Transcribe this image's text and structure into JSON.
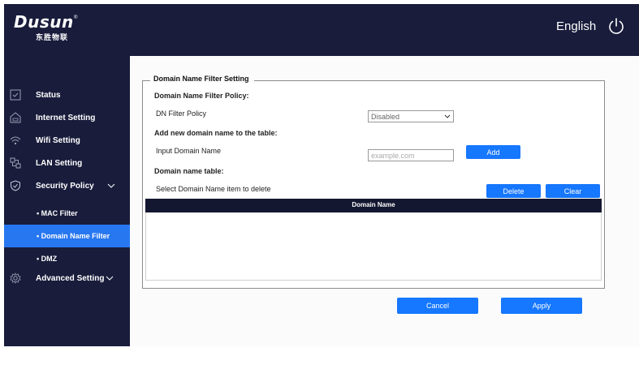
{
  "header": {
    "logo_text": "Dusun",
    "logo_subtext": "东胜物联",
    "logo_reg": "®",
    "language": "English",
    "power_icon": "power-icon"
  },
  "sidebar": {
    "items": [
      {
        "label": "Status",
        "icon": "status-icon"
      },
      {
        "label": "Internet Setting",
        "icon": "internet-icon"
      },
      {
        "label": "Wifi Setting",
        "icon": "wifi-icon"
      },
      {
        "label": "LAN Setting",
        "icon": "lan-icon"
      },
      {
        "label": "Security Policy",
        "icon": "shield-icon",
        "expanded": true
      },
      {
        "label": "Advanced Setting",
        "icon": "gear-icon",
        "expanded": false
      }
    ],
    "security_subitems": [
      {
        "label": "• MAC Filter"
      },
      {
        "label": "• Domain Name Filter",
        "active": true
      },
      {
        "label": "• DMZ"
      }
    ]
  },
  "form": {
    "legend": "Domain Name Filter Setting",
    "policy_heading": "Domain Name Filter Policy:",
    "policy_label": "DN Filter Policy",
    "policy_value": "Disabled",
    "add_heading": "Add new domain name to the table:",
    "input_label": "Input Domain Name",
    "input_placeholder": "example.com",
    "add_button": "Add",
    "table_heading": "Domain name table:",
    "select_label": "Select Domain Name item to delete",
    "delete_button": "Delete",
    "clear_button": "Clear",
    "table_columns": [
      "Domain Name"
    ],
    "table_rows": []
  },
  "footer": {
    "cancel_button": "Cancel",
    "apply_button": "Apply"
  },
  "colors": {
    "sidebar_bg": "#191c3b",
    "accent": "#1677ff",
    "active_item": "#2777f0"
  }
}
